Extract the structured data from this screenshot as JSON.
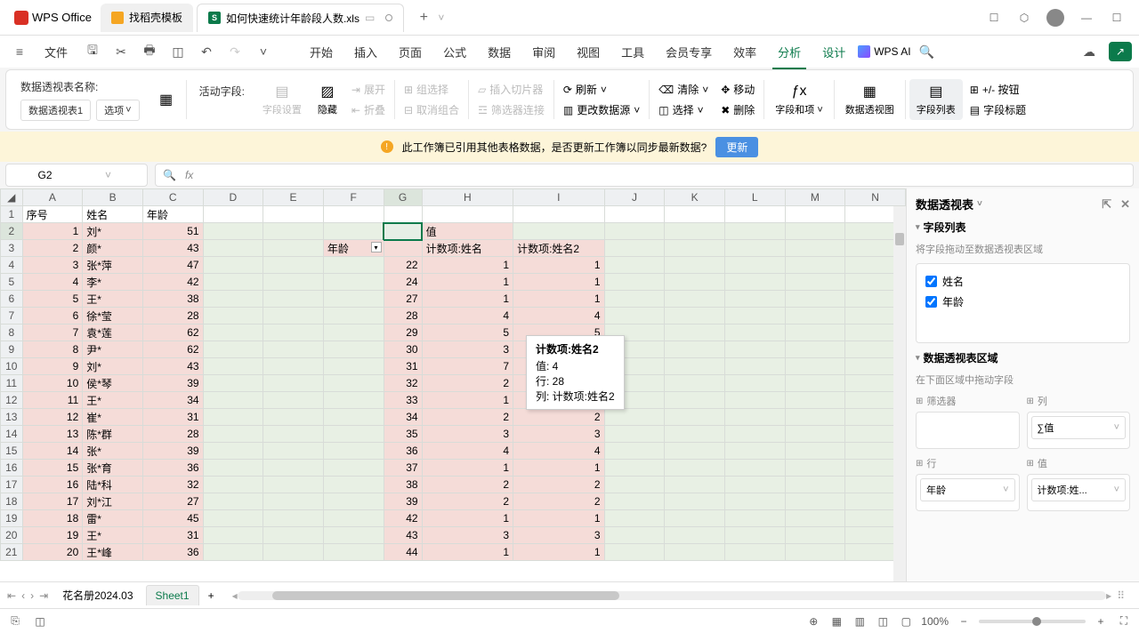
{
  "app": {
    "name": "WPS Office"
  },
  "tabs": [
    {
      "label": "找稻壳模板",
      "active": false
    },
    {
      "label": "如何快速统计年龄段人数.xls",
      "active": true
    }
  ],
  "menu": {
    "file": "文件",
    "items": [
      "开始",
      "插入",
      "页面",
      "公式",
      "数据",
      "审阅",
      "视图",
      "工具",
      "会员专享",
      "效率",
      "分析",
      "设计"
    ],
    "active": "分析",
    "wps_ai": "WPS AI"
  },
  "ribbon": {
    "name_label": "数据透视表名称:",
    "name_value": "数据透视表1",
    "options": "选项",
    "active_field": "活动字段:",
    "field_settings": "字段设置",
    "hide": "隐藏",
    "expand": "展开",
    "collapse": "折叠",
    "group_select": "组选择",
    "ungroup": "取消组合",
    "insert_slicer": "插入切片器",
    "filter_conn": "筛选器连接",
    "refresh": "刷新",
    "change_source": "更改数据源",
    "clear": "清除",
    "select": "选择",
    "move": "移动",
    "delete": "删除",
    "field_items": "字段和项",
    "pivot_chart": "数据透视图",
    "field_list": "字段列表",
    "buttons": "+/- 按钮",
    "field_headers": "字段标题"
  },
  "info_bar": {
    "msg": "此工作簿已引用其他表格数据，是否更新工作簿以同步最新数据?",
    "btn": "更新"
  },
  "name_box": "G2",
  "fx": "fx",
  "columns": [
    "A",
    "B",
    "C",
    "D",
    "E",
    "F",
    "G",
    "H",
    "I",
    "J",
    "K",
    "L",
    "M",
    "N"
  ],
  "header_row": {
    "a": "序号",
    "b": "姓名",
    "c": "年龄"
  },
  "pivot_labels": {
    "h1": "值",
    "f": "年龄",
    "h": "计数项:姓名",
    "i": "计数项:姓名2"
  },
  "rows": [
    {
      "n": 1,
      "a": "1",
      "b": "刘*",
      "c": "51",
      "g": "",
      "h": "",
      "i": ""
    },
    {
      "n": 2,
      "a": "2",
      "b": "颜*",
      "c": "43",
      "g": "",
      "h": "",
      "i": ""
    },
    {
      "n": 3,
      "a": "3",
      "b": "张*萍",
      "c": "47",
      "g": "22",
      "h": "1",
      "i": "1"
    },
    {
      "n": 4,
      "a": "4",
      "b": "李*",
      "c": "42",
      "g": "24",
      "h": "1",
      "i": "1"
    },
    {
      "n": 5,
      "a": "5",
      "b": "王*",
      "c": "38",
      "g": "27",
      "h": "1",
      "i": "1"
    },
    {
      "n": 6,
      "a": "6",
      "b": "徐*莹",
      "c": "28",
      "g": "28",
      "h": "4",
      "i": "4"
    },
    {
      "n": 7,
      "a": "7",
      "b": "袁*莲",
      "c": "62",
      "g": "29",
      "h": "5",
      "i": "5"
    },
    {
      "n": 8,
      "a": "8",
      "b": "尹*",
      "c": "62",
      "g": "30",
      "h": "3",
      "i": ""
    },
    {
      "n": 9,
      "a": "9",
      "b": "刘*",
      "c": "43",
      "g": "31",
      "h": "7",
      "i": ""
    },
    {
      "n": 10,
      "a": "10",
      "b": "侯*琴",
      "c": "39",
      "g": "32",
      "h": "2",
      "i": ""
    },
    {
      "n": 11,
      "a": "11",
      "b": "王*",
      "c": "34",
      "g": "33",
      "h": "1",
      "i": ""
    },
    {
      "n": 12,
      "a": "12",
      "b": "崔*",
      "c": "31",
      "g": "34",
      "h": "2",
      "i": "2"
    },
    {
      "n": 13,
      "a": "13",
      "b": "陈*群",
      "c": "28",
      "g": "35",
      "h": "3",
      "i": "3"
    },
    {
      "n": 14,
      "a": "14",
      "b": "张*",
      "c": "39",
      "g": "36",
      "h": "4",
      "i": "4"
    },
    {
      "n": 15,
      "a": "15",
      "b": "张*育",
      "c": "36",
      "g": "37",
      "h": "1",
      "i": "1"
    },
    {
      "n": 16,
      "a": "16",
      "b": "陆*科",
      "c": "32",
      "g": "38",
      "h": "2",
      "i": "2"
    },
    {
      "n": 17,
      "a": "17",
      "b": "刘*江",
      "c": "27",
      "g": "39",
      "h": "2",
      "i": "2"
    },
    {
      "n": 18,
      "a": "18",
      "b": "雷*",
      "c": "45",
      "g": "42",
      "h": "1",
      "i": "1"
    },
    {
      "n": 19,
      "a": "19",
      "b": "王*",
      "c": "31",
      "g": "43",
      "h": "3",
      "i": "3"
    },
    {
      "n": 20,
      "a": "20",
      "b": "王*峰",
      "c": "36",
      "g": "44",
      "h": "1",
      "i": "1"
    }
  ],
  "tooltip": {
    "title": "计数项:姓名2",
    "l1": "值: 4",
    "l2": "行: 28",
    "l3": "列: 计数项:姓名2"
  },
  "pivot_panel": {
    "title": "数据透视表",
    "field_list": "字段列表",
    "drag_hint": "将字段拖动至数据透视表区域",
    "fields": [
      {
        "label": "姓名",
        "checked": true
      },
      {
        "label": "年龄",
        "checked": true
      }
    ],
    "areas_title": "数据透视表区域",
    "areas_hint": "在下面区域中拖动字段",
    "filter_label": "筛选器",
    "column_label": "列",
    "row_label": "行",
    "value_label": "值",
    "col_item": "∑值",
    "row_item": "年龄",
    "val_item": "计数项:姓..."
  },
  "sheets": {
    "s1": "花名册2024.03",
    "s2": "Sheet1"
  },
  "status": {
    "zoom": "100%"
  }
}
